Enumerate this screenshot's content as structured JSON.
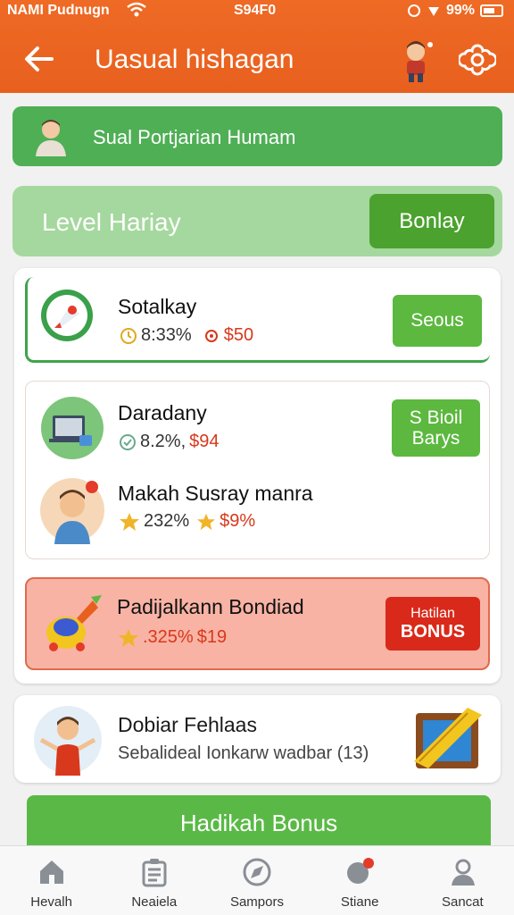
{
  "status_bar": {
    "carrier": "NAMI Pudnugn",
    "time": "S94F0",
    "battery": "99%"
  },
  "header": {
    "title": "Uasual hishagan"
  },
  "user_banner": {
    "name": "Sual Portjarian Humam"
  },
  "level": {
    "label": "Level Hariay",
    "button": "Bonlay"
  },
  "rows": [
    {
      "title": "Sotalkay",
      "percent": "8:33%",
      "amount": "$50",
      "button": "Seous"
    },
    {
      "title": "Daradany",
      "percent": "8.2%,",
      "amount": "$94",
      "button": "S Bioil Barys"
    },
    {
      "title": "Makah Susray manra",
      "percent": "232%",
      "amount": "$9%"
    },
    {
      "title": "Padijalkann Bondiad",
      "percent": ".325%",
      "amount": "$19",
      "button_top": "Hatilan",
      "button_bottom": "BONUS"
    }
  ],
  "promo": {
    "title": "Dobiar Fehlaas",
    "subtitle": "Sebalideal Ionkarw wadbar (13)"
  },
  "cta": {
    "label": "Hadikah Bonus"
  },
  "bottom_nav": [
    {
      "label": "Hevalh",
      "icon": "home-icon"
    },
    {
      "label": "Neaiela",
      "icon": "list-icon"
    },
    {
      "label": "Sampors",
      "icon": "compass-icon"
    },
    {
      "label": "Stiane",
      "icon": "notification-icon"
    },
    {
      "label": "Sancat",
      "icon": "profile-icon"
    }
  ],
  "colors": {
    "header": "#e8601e",
    "green": "#4faf55",
    "accent_red": "#d9291a"
  }
}
